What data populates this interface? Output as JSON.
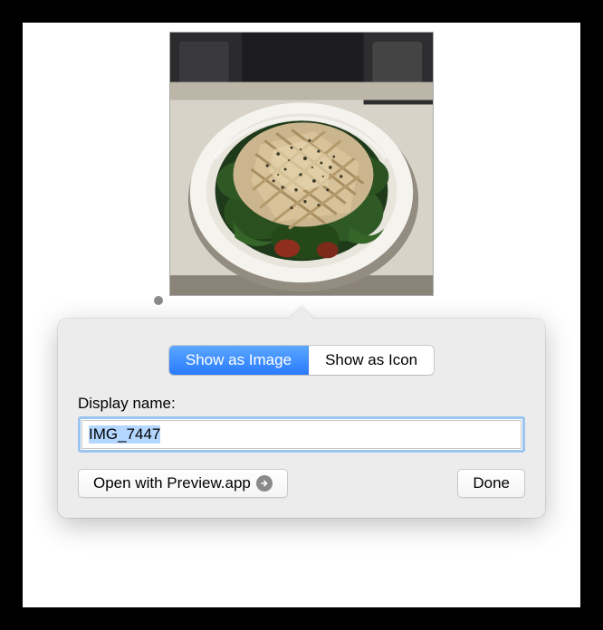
{
  "segmented": {
    "show_as_image": "Show as Image",
    "show_as_icon": "Show as Icon"
  },
  "display_name": {
    "label": "Display name:",
    "value": "IMG_7447"
  },
  "buttons": {
    "open_with": "Open with Preview.app",
    "done": "Done"
  }
}
